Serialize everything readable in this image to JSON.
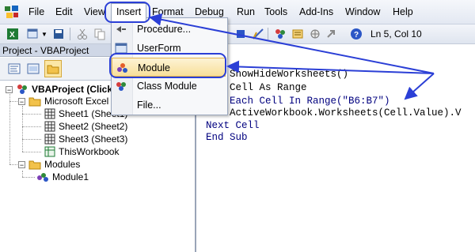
{
  "menubar": {
    "items": [
      "File",
      "Edit",
      "View",
      "Insert",
      "Format",
      "Debug",
      "Run",
      "Tools",
      "Add-Ins",
      "Window",
      "Help"
    ]
  },
  "toolbar": {
    "position": "Ln 5, Col 10"
  },
  "insert_menu": {
    "items": [
      "Procedure...",
      "UserForm",
      "Module",
      "Class Module",
      "File..."
    ],
    "highlighted": "Module"
  },
  "project": {
    "title": "Project - VBAProject",
    "root": "VBAProject (Click",
    "folder_objects": "Microsoft Excel O",
    "sheets": [
      "Sheet1 (Sheet1)",
      "Sheet2 (Sheet2)",
      "Sheet3 (Sheet3)"
    ],
    "workbook": "ThisWorkbook",
    "folder_modules": "Modules",
    "module": "Module1"
  },
  "code": {
    "lines": [
      ")",
      "ShowHideWorksheets()",
      "Cell As Range",
      "Each Cell In Range(\"B6:B7\")",
      "ActiveWorkbook.Worksheets(Cell.Value).V",
      "Next Cell",
      "End Sub"
    ]
  },
  "colors": {
    "annotation": "#2b3fd6",
    "keyword": "#00007f",
    "highlight_border": "#e2b44e"
  }
}
